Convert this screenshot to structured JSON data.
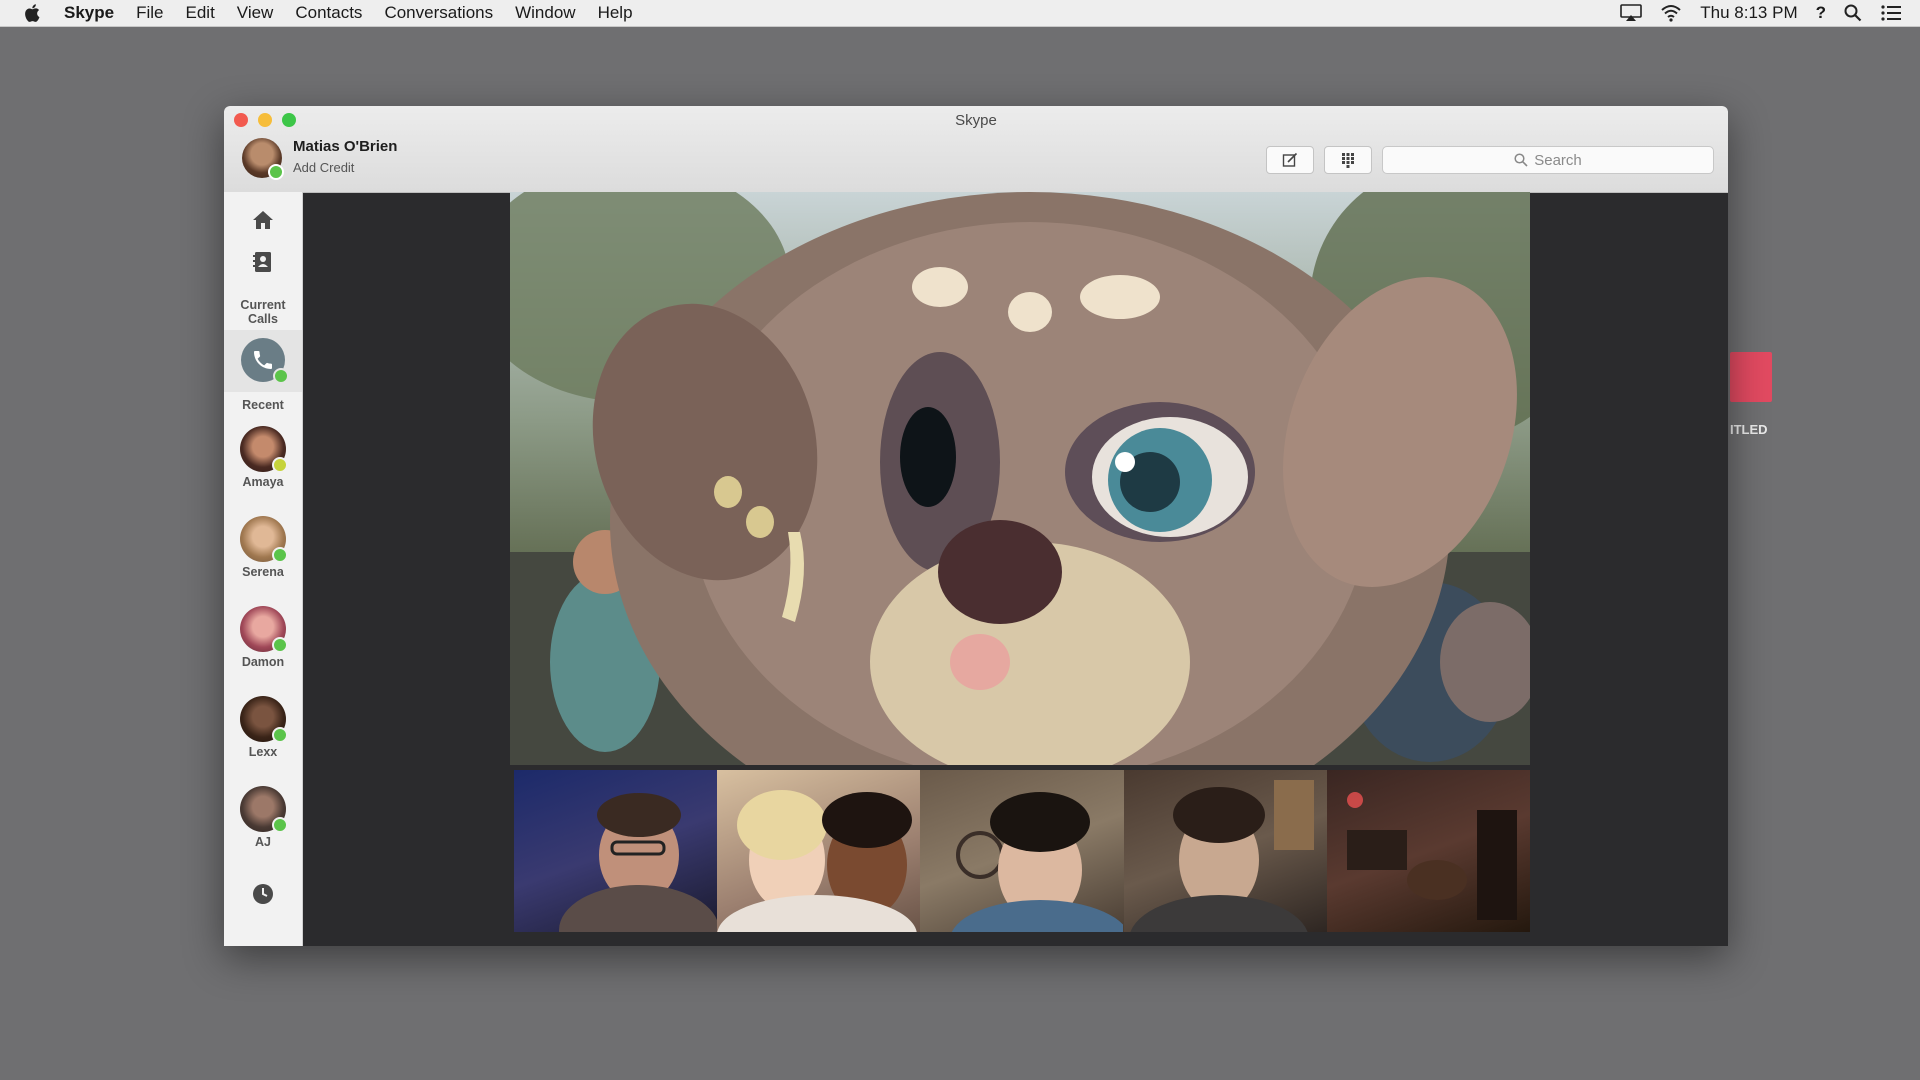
{
  "menubar": {
    "app_name": "Skype",
    "items": [
      "File",
      "Edit",
      "View",
      "Contacts",
      "Conversations",
      "Window",
      "Help"
    ],
    "clock": "Thu 8:13 PM",
    "help_glyph": "?"
  },
  "window": {
    "title": "Skype",
    "profile": {
      "name": "Matias O'Brien",
      "sub": "Add Credit",
      "status_color": "#5bc44a"
    },
    "search_placeholder": "Search"
  },
  "sidebar": {
    "current_calls_label": "Current Calls",
    "recent_label": "Recent",
    "contacts": [
      {
        "name": "Amaya",
        "status": "away",
        "status_color": "#c6d33b"
      },
      {
        "name": "Serena",
        "status": "online",
        "status_color": "#5bc44a"
      },
      {
        "name": "Damon",
        "status": "online",
        "status_color": "#5bc44a"
      },
      {
        "name": "Lexx",
        "status": "online",
        "status_color": "#5bc44a"
      },
      {
        "name": "AJ",
        "status": "online",
        "status_color": "#5bc44a"
      }
    ]
  },
  "background_window": {
    "label": "ITLED"
  },
  "icons": {
    "home": "home-icon",
    "contacts": "contacts-book-icon",
    "call": "phone-icon",
    "history": "clock-icon",
    "compose": "compose-icon",
    "dialpad": "dialpad-icon",
    "search": "search-icon"
  }
}
